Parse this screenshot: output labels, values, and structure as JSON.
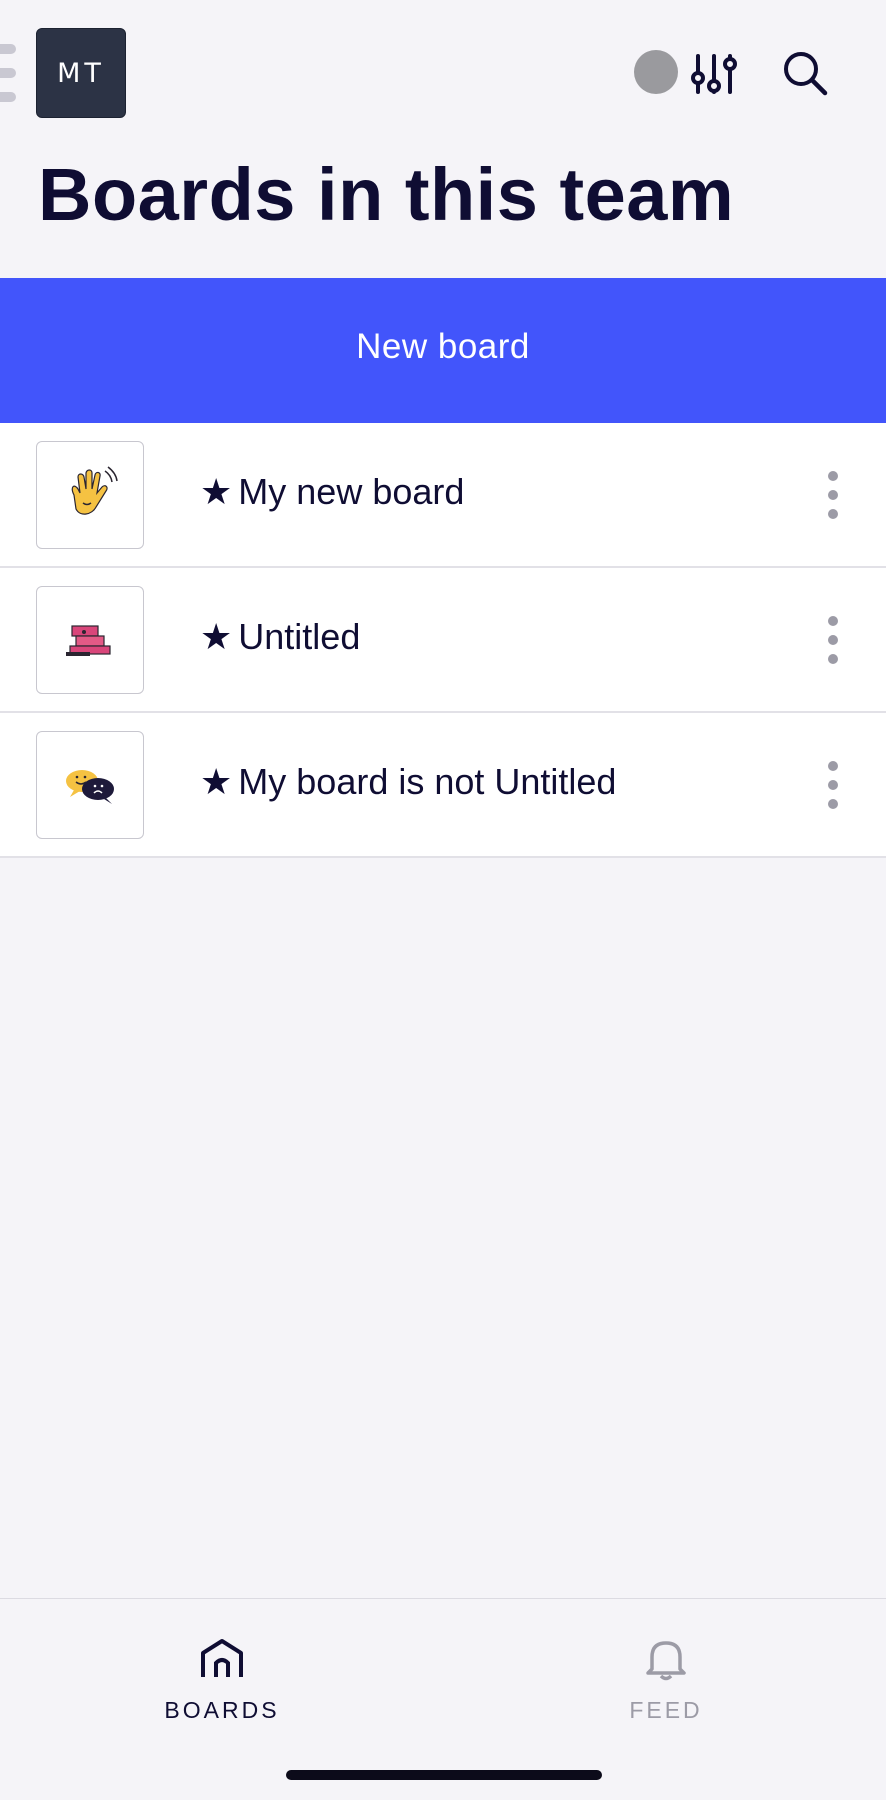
{
  "header": {
    "team_initials": "MT",
    "title": "Boards in this team",
    "icons": [
      "menu-handle-icon",
      "status-dot-icon",
      "filter-icon",
      "search-icon"
    ]
  },
  "new_board": {
    "label": "New board",
    "color": "#4255fb"
  },
  "boards": [
    {
      "star": "★",
      "title": "My new board",
      "thumbnail": "waving-hand-icon"
    },
    {
      "star": "★",
      "title": "Untitled",
      "thumbnail": "books-icon"
    },
    {
      "star": "★",
      "title": "My board is not Untitled",
      "thumbnail": "chat-bubbles-icon"
    }
  ],
  "bottom_nav": {
    "tabs": [
      {
        "label": "BOARDS",
        "icon": "home-icon",
        "active": true
      },
      {
        "label": "FEED",
        "icon": "bell-icon",
        "active": false
      }
    ]
  }
}
